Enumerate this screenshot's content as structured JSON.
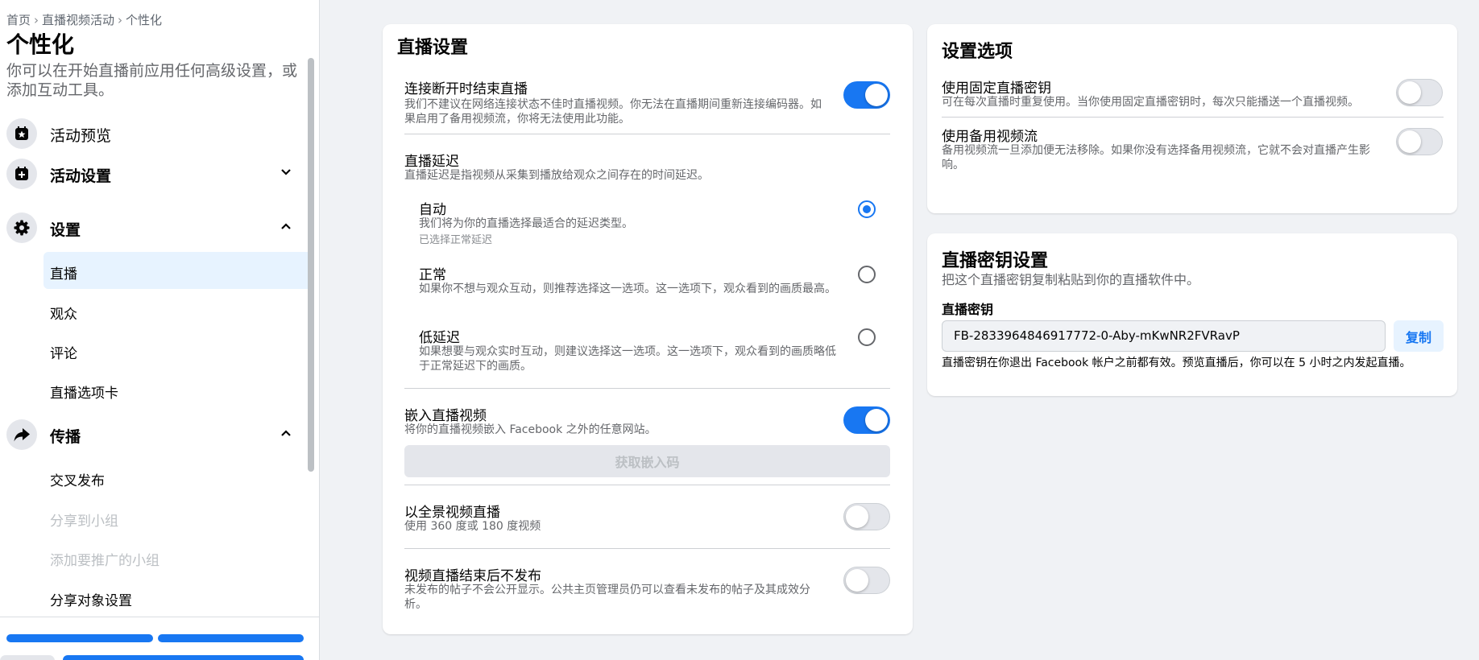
{
  "breadcrumb": [
    "首页",
    "直播视频活动",
    "个性化"
  ],
  "sidebar": {
    "title": "个性化",
    "description": "你可以在开始直播前应用任何高级设置，或添加互动工具。",
    "sections": [
      {
        "label": "活动预览",
        "icon": "star-calendar-icon"
      },
      {
        "label": "活动设置",
        "icon": "calendar-add-icon",
        "expanded": false
      },
      {
        "label": "设置",
        "icon": "gear-icon",
        "expanded": true
      },
      {
        "label": "传播",
        "icon": "share-arrow-icon",
        "expanded": true
      }
    ],
    "settings_items": [
      "直播",
      "观众",
      "评论",
      "直播选项卡"
    ],
    "distribution_items": [
      {
        "label": "交叉发布",
        "enabled": true
      },
      {
        "label": "分享到小组",
        "enabled": false
      },
      {
        "label": "添加要推广的小组",
        "enabled": false
      },
      {
        "label": "分享对象设置",
        "enabled": true
      }
    ],
    "active_item": "直播"
  },
  "live_settings": {
    "title": "直播设置",
    "end_on_disconnect": {
      "title": "连接断开时结束直播",
      "desc": "我们不建议在网络连接状态不佳时直播视频。你无法在直播期间重新连接编码器。如果启用了备用视频流，你将无法使用此功能。",
      "on": true
    },
    "latency": {
      "title": "直播延迟",
      "desc": "直播延迟是指视频从采集到播放给观众之间存在的时间延迟。",
      "options": [
        {
          "title": "自动",
          "desc": "我们将为你的直播选择最适合的延迟类型。",
          "note": "已选择正常延迟",
          "selected": true
        },
        {
          "title": "正常",
          "desc": "如果你不想与观众互动，则推荐选择这一选项。这一选项下，观众看到的画质最高。",
          "selected": false
        },
        {
          "title": "低延迟",
          "desc": "如果想要与观众实时互动，则建议选择这一选项。这一选项下，观众看到的画质略低于正常延迟下的画质。",
          "selected": false
        }
      ]
    },
    "embed": {
      "title": "嵌入直播视频",
      "desc": "将你的直播视频嵌入 Facebook 之外的任意网站。",
      "button": "获取嵌入码",
      "on": true
    },
    "panorama": {
      "title": "以全景视频直播",
      "desc": "使用 360 度或 180 度视频",
      "on": false
    },
    "unpublish": {
      "title": "视频直播结束后不发布",
      "desc": "未发布的帖子不会公开显示。公共主页管理员仍可以查看未发布的帖子及其成效分析。",
      "on": false
    }
  },
  "setup_options": {
    "title": "设置选项",
    "persistent_key": {
      "title": "使用固定直播密钥",
      "desc": "可在每次直播时重复使用。当你使用固定直播密钥时，每次只能播送一个直播视频。",
      "on": false
    },
    "backup_stream": {
      "title": "使用备用视频流",
      "desc": "备用视频流一旦添加便无法移除。如果你没有选择备用视频流，它就不会对直播产生影响。",
      "on": false
    }
  },
  "stream_key": {
    "title": "直播密钥设置",
    "subtitle": "把这个直播密钥复制粘贴到你的直播软件中。",
    "label": "直播密钥",
    "value": "FB-2833964846917772-0-Aby-mKwNR2FVRavP",
    "copy_button": "复制",
    "note": "直播密钥在你退出 Facebook 帐户之前都有效。预览直播后，你可以在 5 小时之内发起直播。"
  },
  "colors": {
    "accent": "#1877f2",
    "active_bg": "#e7f3ff",
    "page_bg": "#f0f2f5"
  }
}
